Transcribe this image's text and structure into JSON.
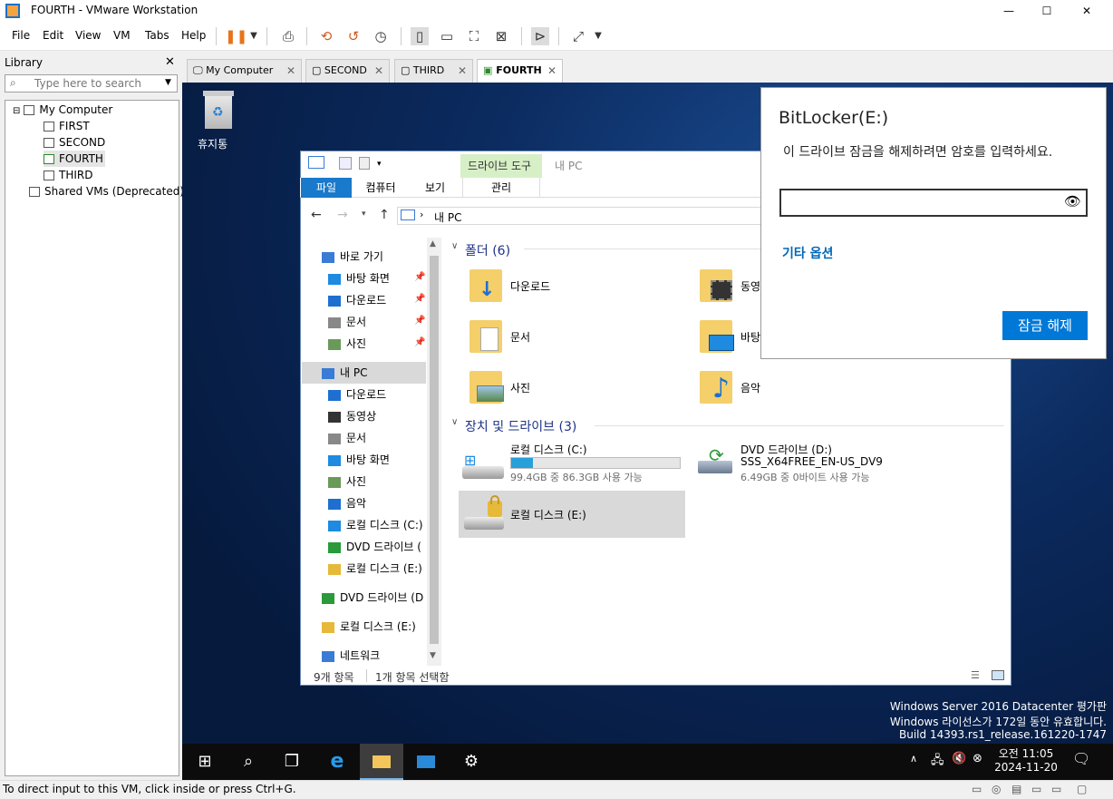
{
  "window": {
    "title": "FOURTH - VMware Workstation",
    "minimize": "—",
    "maximize": "☐",
    "close": "✕"
  },
  "menu": [
    "File",
    "Edit",
    "View",
    "VM",
    "Tabs",
    "Help"
  ],
  "library": {
    "title": "Library",
    "close": "✕",
    "search_placeholder": "Type here to search",
    "tree": [
      {
        "label": "My Computer",
        "level": 0
      },
      {
        "label": "FIRST",
        "level": 1
      },
      {
        "label": "SECOND",
        "level": 1
      },
      {
        "label": "FOURTH",
        "level": 1
      },
      {
        "label": "THIRD",
        "level": 1
      },
      {
        "label": "Shared VMs (Deprecated)",
        "level": 0
      }
    ]
  },
  "tabs": [
    {
      "label": "My Computer",
      "active": false
    },
    {
      "label": "SECOND",
      "active": false
    },
    {
      "label": "THIRD",
      "active": false
    },
    {
      "label": "FOURTH",
      "active": true
    }
  ],
  "desktop": {
    "recycle_bin": "휴지통"
  },
  "explorer": {
    "ribbon_context": "드라이브 도구",
    "ribbon_title": "내 PC",
    "ribbon_tabs": [
      "파일",
      "컴퓨터",
      "보기",
      "관리"
    ],
    "address": "내 PC",
    "nav": [
      {
        "label": "바로 가기",
        "indent": 0,
        "pinned": false
      },
      {
        "label": "바탕 화면",
        "indent": 1,
        "pinned": true
      },
      {
        "label": "다운로드",
        "indent": 1,
        "pinned": true
      },
      {
        "label": "문서",
        "indent": 1,
        "pinned": true
      },
      {
        "label": "사진",
        "indent": 1,
        "pinned": true
      },
      {
        "label": "내 PC",
        "indent": 0,
        "pinned": false
      },
      {
        "label": "다운로드",
        "indent": 1,
        "pinned": false
      },
      {
        "label": "동영상",
        "indent": 1,
        "pinned": false
      },
      {
        "label": "문서",
        "indent": 1,
        "pinned": false
      },
      {
        "label": "바탕 화면",
        "indent": 1,
        "pinned": false
      },
      {
        "label": "사진",
        "indent": 1,
        "pinned": false
      },
      {
        "label": "음악",
        "indent": 1,
        "pinned": false
      },
      {
        "label": "로컬 디스크 (C:)",
        "indent": 1,
        "pinned": false
      },
      {
        "label": "DVD 드라이브 (",
        "indent": 1,
        "pinned": false
      },
      {
        "label": "로컬 디스크 (E:)",
        "indent": 1,
        "pinned": false
      },
      {
        "label": "DVD 드라이브 (D",
        "indent": 0,
        "pinned": false
      },
      {
        "label": "로컬 디스크 (E:)",
        "indent": 0,
        "pinned": false
      },
      {
        "label": "네트워크",
        "indent": 0,
        "pinned": false
      }
    ],
    "folders_header": "폴더 (6)",
    "folders": [
      "다운로드",
      "동영",
      "문서",
      "바탕",
      "사진",
      "음악"
    ],
    "drives_header": "장치 및 드라이브 (3)",
    "drive_c": {
      "name": "로컬 디스크 (C:)",
      "free": "99.4GB 중 86.3GB 사용 가능",
      "used_fraction": 0.13
    },
    "drive_d": {
      "name": "DVD 드라이브 (D:)",
      "label": "SSS_X64FREE_EN-US_DV9",
      "free": "6.49GB 중 0바이트 사용 가능"
    },
    "drive_e": {
      "name": "로컬 디스크 (E:)"
    },
    "status_items": "9개 항목",
    "status_selected": "1개 항목 선택함"
  },
  "bitlocker": {
    "title": "BitLocker(E:)",
    "prompt": "이 드라이브 잠금을 해제하려면 암호를 입력하세요.",
    "more_options": "기타 옵션",
    "unlock_button": "잠금 해제"
  },
  "watermark": [
    "Windows Server 2016 Datacenter 평가판",
    "Windows 라이선스가 172일 동안 유효합니다.",
    "Build 14393.rs1_release.161220-1747"
  ],
  "taskbar": {
    "time": "오전 11:05",
    "date": "2024-11-20"
  },
  "statusbar": {
    "message": "To direct input to this VM, click inside or press Ctrl+G."
  }
}
